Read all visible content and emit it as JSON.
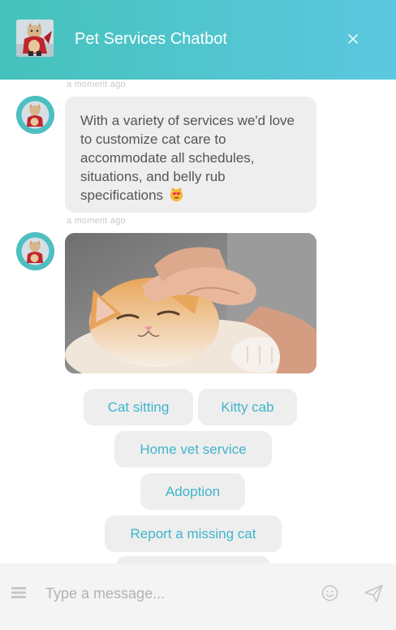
{
  "header": {
    "title": "Pet Services Chatbot",
    "close_icon": "close-icon",
    "avatar_icon": "cat-hero-avatar"
  },
  "conversation": {
    "messages": [
      {
        "timestamp": "a moment ago",
        "type": "text",
        "text": "With a variety of services we'd love to customize cat care to accommodate all schedules, situations, and belly rub specifications",
        "emoji": "heart-eyes-cat-emoji"
      },
      {
        "timestamp": "a moment ago",
        "type": "image",
        "image": "cat-being-petted-photo"
      }
    ]
  },
  "quick_replies": [
    "Cat sitting",
    "Kitty cab",
    "Home vet service",
    "Adoption",
    "Report a missing cat",
    ""
  ],
  "composer": {
    "placeholder": "Type a message...",
    "value": "",
    "menu_icon": "menu-icon",
    "emoji_icon": "smiley-icon",
    "send_icon": "send-icon"
  },
  "colors": {
    "header_gradient_start": "#45c2bb",
    "header_gradient_end": "#5cc8e0",
    "bubble": "#eeeeee",
    "quick_reply_text": "#3fb4cc",
    "composer_bg": "#f4f4f4"
  }
}
